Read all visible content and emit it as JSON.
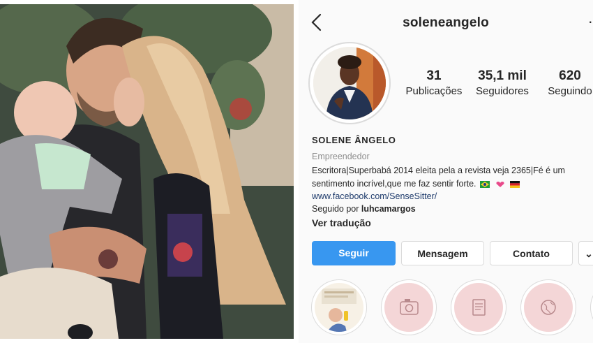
{
  "profile": {
    "username": "soleneangelo",
    "stats": [
      {
        "value": "31",
        "label": "Publicações"
      },
      {
        "value": "35,1 mil",
        "label": "Seguidores"
      },
      {
        "value": "620",
        "label": "Seguindo"
      }
    ],
    "name": "SOLENE ÂNGELO",
    "category": "Empreendedor",
    "bio": "Escritora|Superbabá 2014 eleita pela a revista veja 2365|Fé é um sentimento incrível,que me faz sentir forte.",
    "link": "www.facebook.com/SenseSitter/",
    "followed_by_prefix": "Seguido por",
    "followed_by_user": "luhcamargos",
    "translate": "Ver tradução",
    "buttons": {
      "follow": "Seguir",
      "message": "Mensagem",
      "contact": "Contato",
      "more": "⌄"
    },
    "highlights": [
      "photo-highlight",
      "camera-icon",
      "document-icon",
      "globe-icon"
    ],
    "colors": {
      "accent": "#3897f0",
      "highlight_bg": "#f4d6d7",
      "link": "#1d3a6b"
    }
  }
}
